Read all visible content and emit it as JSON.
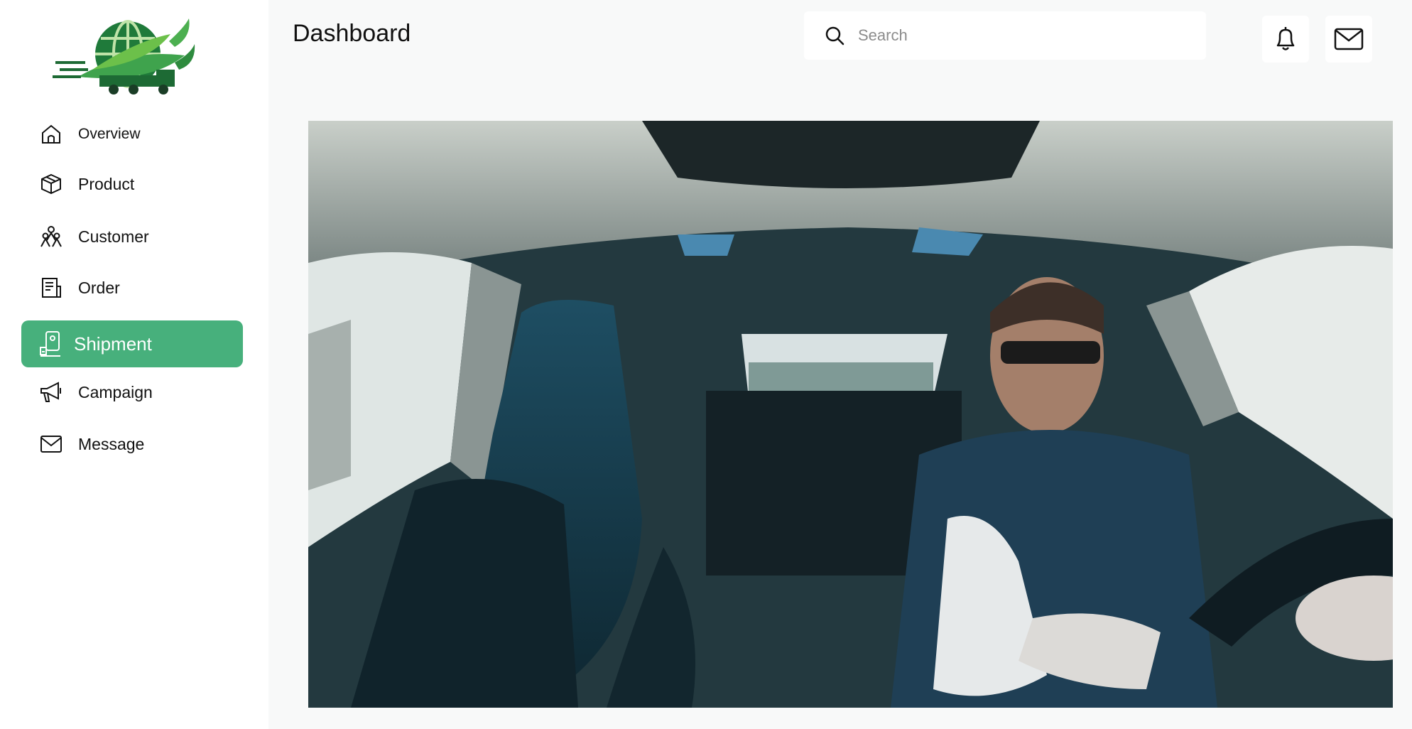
{
  "header": {
    "title": "Dashboard",
    "search_placeholder": "Search",
    "notification_icon": "bell-icon",
    "mail_icon": "mail-icon"
  },
  "sidebar": {
    "items": [
      {
        "label": "Overview",
        "icon": "home-icon"
      },
      {
        "label": "Product",
        "icon": "box-icon"
      },
      {
        "label": "Customer",
        "icon": "users-icon"
      },
      {
        "label": "Order",
        "icon": "document-icon"
      },
      {
        "label": "Shipment",
        "icon": "shipment-icon",
        "active": true
      },
      {
        "label": "Campaign",
        "icon": "megaphone-icon"
      },
      {
        "label": "Message",
        "icon": "mail-icon"
      }
    ]
  },
  "colors": {
    "accent": "#47b07c",
    "background": "#f8f9f9",
    "sidebar": "#ffffff"
  }
}
